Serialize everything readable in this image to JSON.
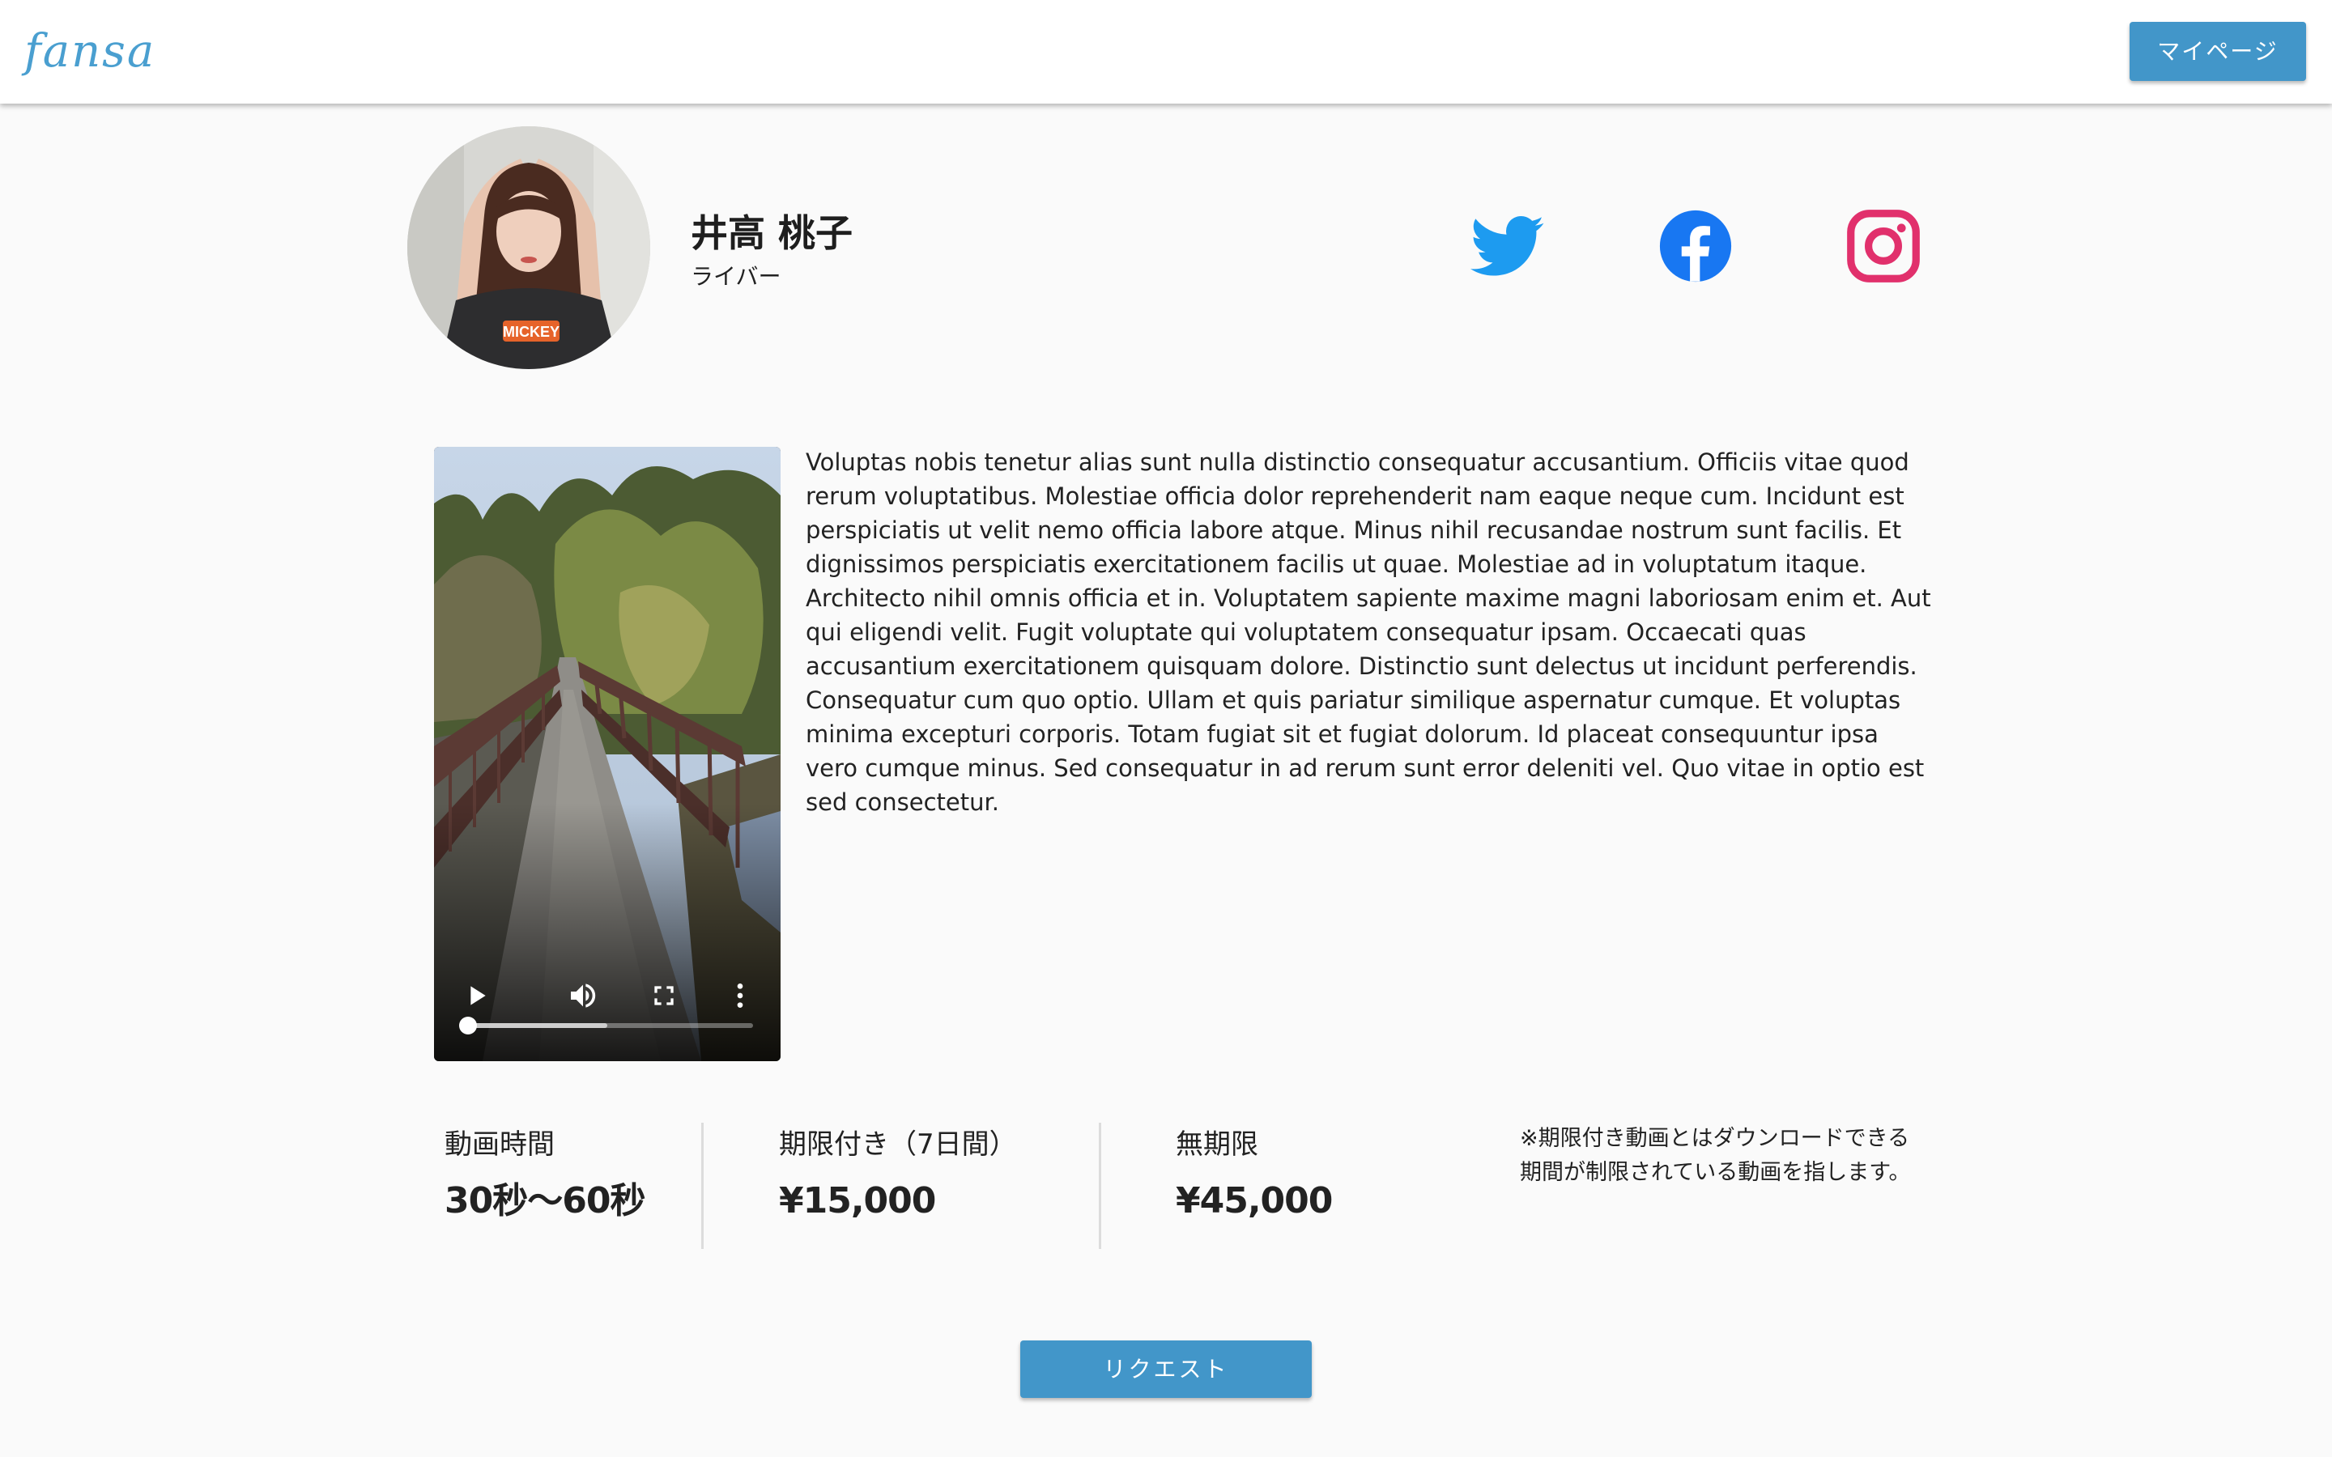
{
  "header": {
    "logo_text": "fansa",
    "mypage_label": "マイページ"
  },
  "profile": {
    "name": "井高 桃子",
    "role": "ライバー",
    "social": [
      {
        "icon": "twitter-icon",
        "color": "#1d9bf0"
      },
      {
        "icon": "facebook-icon",
        "color": "#1877f2"
      },
      {
        "icon": "instagram-icon",
        "color": "#e1306c"
      }
    ]
  },
  "video": {
    "controls": [
      "play-icon",
      "volume-icon",
      "fullscreen-icon",
      "more-options-icon"
    ],
    "played_fraction": 0.0,
    "buffered_fraction": 0.49
  },
  "description": "Voluptas nobis tenetur alias sunt nulla distinctio consequatur accusantium. Officiis vitae quod rerum voluptatibus. Molestiae officia dolor reprehenderit nam eaque neque cum. Incidunt est perspiciatis ut velit nemo officia labore atque. Minus nihil recusandae nostrum sunt facilis. Et dignissimos perspiciatis exercitationem facilis ut quae. Molestiae ad in voluptatum itaque. Architecto nihil omnis officia et in. Voluptatem sapiente maxime magni laboriosam enim et. Aut qui eligendi velit. Fugit voluptate qui voluptatem consequatur ipsam. Occaecati quas accusantium exercitationem quisquam dolore. Distinctio sunt delectus ut incidunt perferendis. Consequatur cum quo optio. Ullam et quis pariatur similique aspernatur cumque. Et voluptas minima excepturi corporis. Totam fugiat sit et fugiat dolorum. Id placeat consequuntur ipsa vero cumque minus. Sed consequatur in ad rerum sunt error deleniti vel. Quo vitae in optio est sed consectetur.",
  "stats": {
    "duration_label": "動画時間",
    "duration_value": "30秒〜60秒",
    "limited_label": "期限付き（7日間）",
    "limited_price": "¥15,000",
    "unlimited_label": "無期限",
    "unlimited_price": "¥45,000",
    "note": "※期限付き動画とはダウンロードできる期間が制限されている動画を指します。"
  },
  "actions": {
    "request_label": "リクエスト"
  },
  "colors": {
    "primary_button": "#4296c9",
    "logo": "#4a9fd0",
    "background": "#fafafa"
  }
}
